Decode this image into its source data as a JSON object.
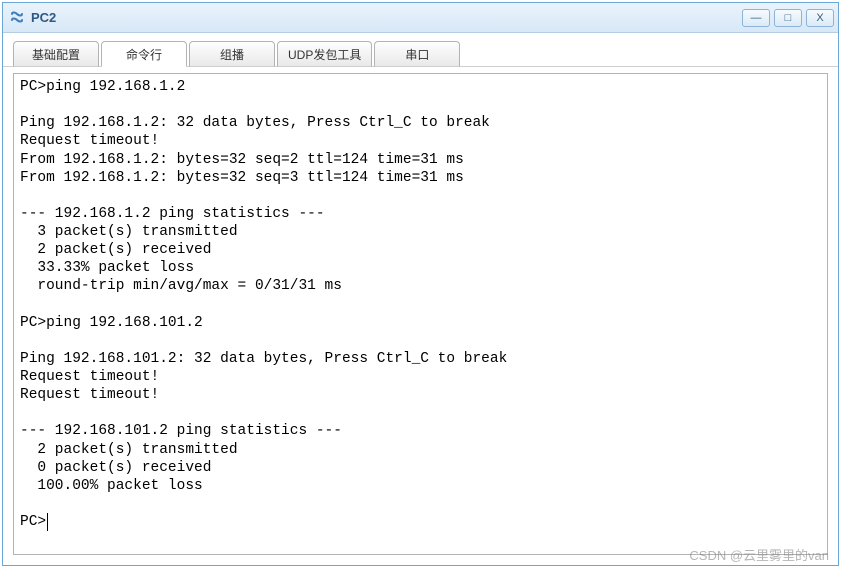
{
  "window": {
    "title": "PC2",
    "icon_name": "app-icon",
    "buttons": {
      "minimize": "—",
      "maximize": "□",
      "close": "X"
    }
  },
  "tabs": [
    {
      "label": "基础配置",
      "active": false
    },
    {
      "label": "命令行",
      "active": true
    },
    {
      "label": "组播",
      "active": false
    },
    {
      "label": "UDP发包工具",
      "active": false
    },
    {
      "label": "串口",
      "active": false
    }
  ],
  "terminal": {
    "prompt": "PC>",
    "sessions": [
      {
        "command": "ping 192.168.1.2",
        "header": "Ping 192.168.1.2: 32 data bytes, Press Ctrl_C to break",
        "lines": [
          "Request timeout!",
          "From 192.168.1.2: bytes=32 seq=2 ttl=124 time=31 ms",
          "From 192.168.1.2: bytes=32 seq=3 ttl=124 time=31 ms"
        ],
        "stats_header": "--- 192.168.1.2 ping statistics ---",
        "stats": [
          "  3 packet(s) transmitted",
          "  2 packet(s) received",
          "  33.33% packet loss",
          "  round-trip min/avg/max = 0/31/31 ms"
        ]
      },
      {
        "command": "ping 192.168.101.2",
        "header": "Ping 192.168.101.2: 32 data bytes, Press Ctrl_C to break",
        "lines": [
          "Request timeout!",
          "Request timeout!"
        ],
        "stats_header": "--- 192.168.101.2 ping statistics ---",
        "stats": [
          "  2 packet(s) transmitted",
          "  0 packet(s) received",
          "  100.00% packet loss"
        ]
      }
    ]
  },
  "watermark": "CSDN @云里雾里的van"
}
